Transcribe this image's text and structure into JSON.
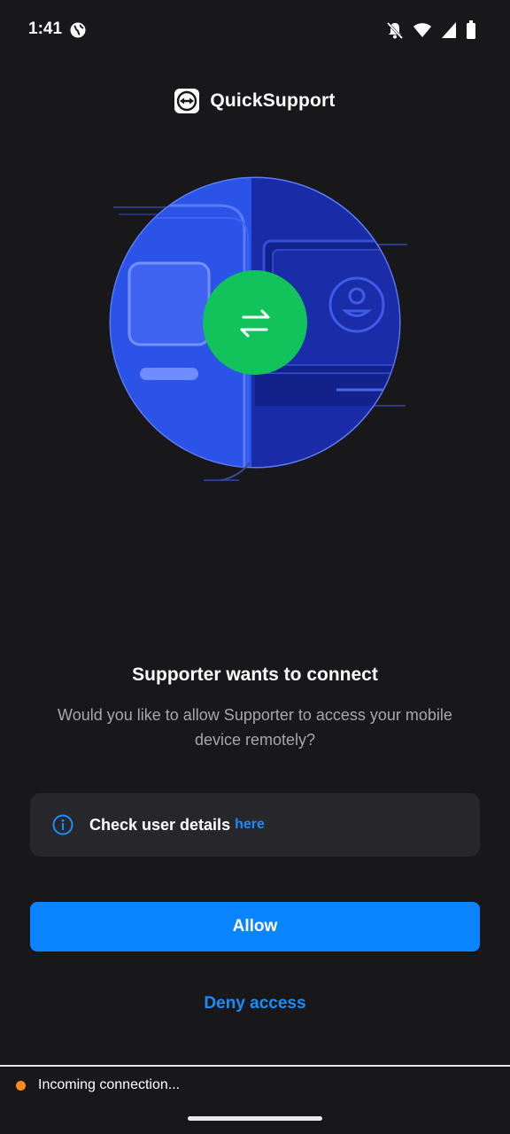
{
  "status_bar": {
    "time": "1:41",
    "icons": [
      "globe-icon",
      "mute-icon",
      "wifi-icon",
      "signal-icon",
      "battery-icon"
    ]
  },
  "header": {
    "app_name": "QuickSupport",
    "logo_icon": "teamviewer-logo-icon"
  },
  "dialog": {
    "title": "Supporter wants to connect",
    "message": "Would you like to allow Supporter to access your mobile device remotely?",
    "info": {
      "icon": "info-icon",
      "text": "Check user details",
      "link": "here"
    },
    "allow_label": "Allow",
    "deny_label": "Deny access"
  },
  "footer": {
    "status_text": "Incoming connection...",
    "status_color": "#ff8a1f"
  },
  "colors": {
    "background": "#18181b",
    "accent": "#0a84ff",
    "link": "#1d8cf8",
    "card": "#26262b",
    "illustration_blue": "#1f3bb3",
    "illustration_green": "#12c25a"
  }
}
